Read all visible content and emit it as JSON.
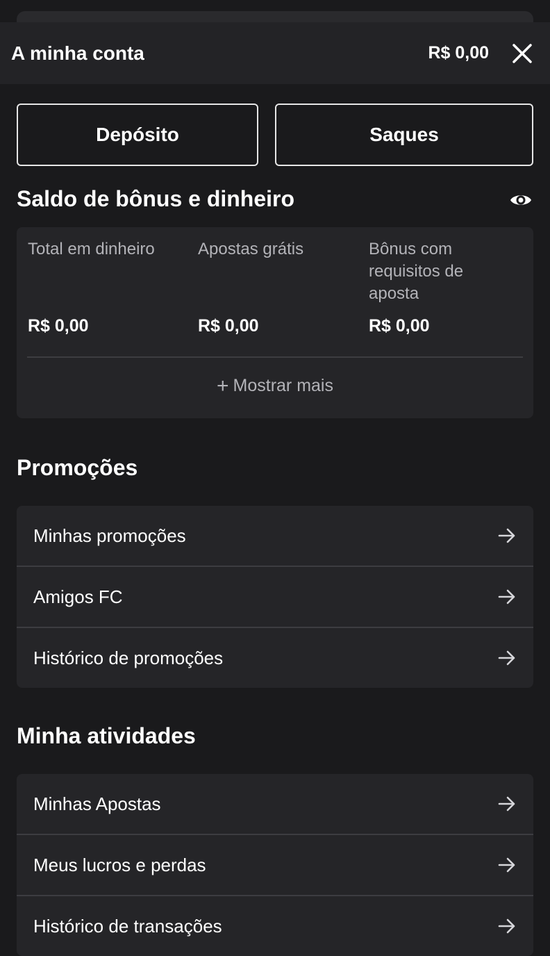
{
  "header": {
    "title": "A minha conta",
    "balance": "R$ 0,00"
  },
  "actions": {
    "deposit_label": "Depósito",
    "withdraw_label": "Saques"
  },
  "balance_section": {
    "title": "Saldo de bônus e dinheiro",
    "columns": [
      {
        "label": "Total em dinheiro",
        "value": "R$ 0,00"
      },
      {
        "label": "Apostas grátis",
        "value": "R$ 0,00"
      },
      {
        "label": "Bônus com requisitos de aposta",
        "value": "R$ 0,00"
      }
    ],
    "show_more_label": "Mostrar mais"
  },
  "promotions": {
    "title": "Promoções",
    "items": [
      {
        "label": "Minhas promoções"
      },
      {
        "label": "Amigos FC"
      },
      {
        "label": "Histórico de promoções"
      }
    ]
  },
  "activities": {
    "title": "Minha atividades",
    "items": [
      {
        "label": "Minhas Apostas"
      },
      {
        "label": "Meus lucros e perdas"
      },
      {
        "label": "Histórico de transações"
      }
    ]
  },
  "colors": {
    "background": "#1a1a1c",
    "header": "#232326",
    "card": "#252528",
    "muted_text": "#b3b3b8"
  }
}
